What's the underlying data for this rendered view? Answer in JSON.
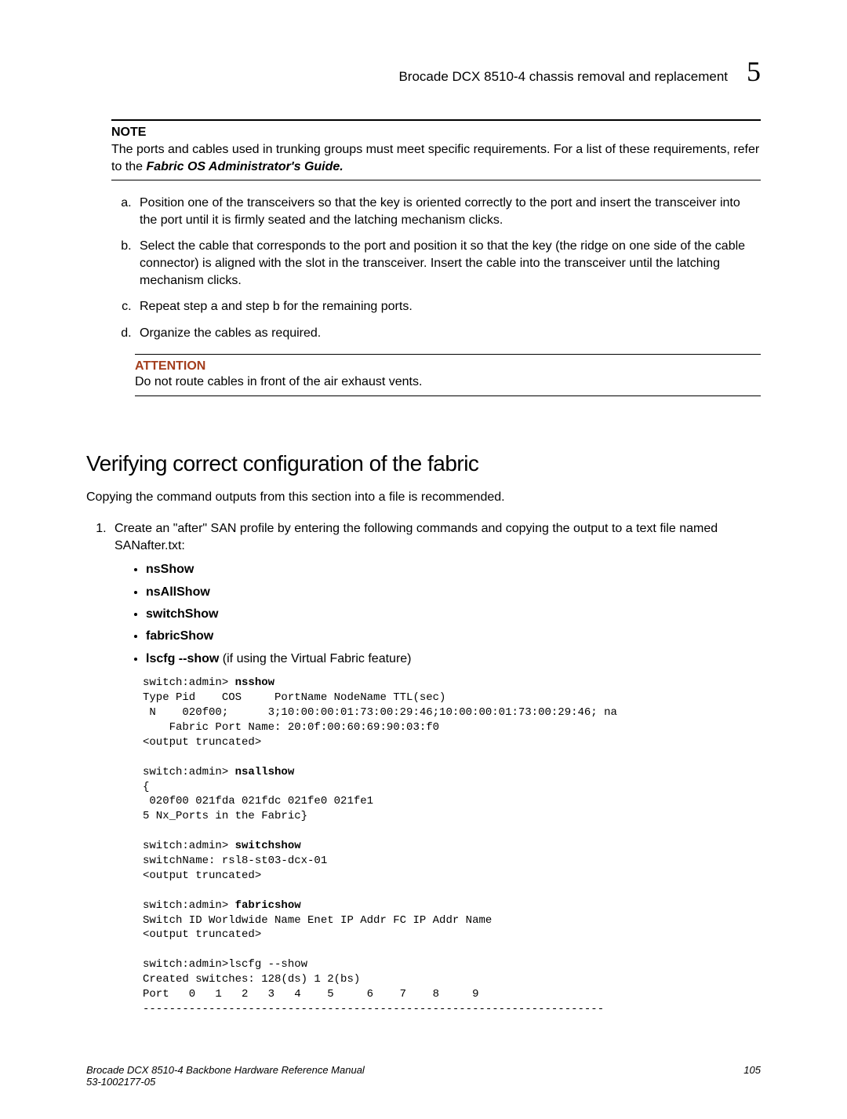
{
  "header": {
    "title": "Brocade DCX 8510-4 chassis removal and replacement",
    "chapter": "5"
  },
  "note": {
    "label": "NOTE",
    "text_before_italic": "The ports and cables used in trunking groups must meet specific requirements. For a list of these requirements, refer to the ",
    "italic": "Fabric OS Administrator's Guide."
  },
  "steps": [
    "Position one of the transceivers so that the key is oriented correctly to the port and insert the transceiver into the port until it is firmly seated and the latching mechanism clicks.",
    "Select the cable that corresponds to the port and position it so that the key (the ridge on one side of the cable connector) is aligned with the slot in the transceiver. Insert the cable into the transceiver until the latching mechanism clicks.",
    "Repeat step a and step b for the remaining ports.",
    "Organize the cables as required."
  ],
  "attention": {
    "label": "ATTENTION",
    "text": "Do not route cables in front of the air exhaust vents."
  },
  "section": {
    "heading": "Verifying correct configuration of the fabric",
    "intro": "Copying the command outputs from this section into a file is recommended.",
    "step1_text": "Create an \"after\" SAN profile by entering the following commands and copying the output to a text file named SANafter.txt:",
    "commands": [
      {
        "cmd": "nsShow",
        "suffix": ""
      },
      {
        "cmd": "nsAllShow",
        "suffix": ""
      },
      {
        "cmd": "switchShow",
        "suffix": ""
      },
      {
        "cmd": "fabricShow",
        "suffix": ""
      },
      {
        "cmd": "lscfg --show",
        "suffix": " (if using the Virtual Fabric feature)"
      }
    ],
    "code": {
      "p1": "switch:admin> ",
      "c1": "nsshow",
      "l2": "Type Pid    COS     PortName NodeName TTL(sec)",
      "l3": " N    020f00;      3;10:00:00:01:73:00:29:46;10:00:00:01:73:00:29:46; na",
      "l4": "    Fabric Port Name: 20:0f:00:60:69:90:03:f0",
      "l5": "<output truncated>",
      "blank1": "",
      "p2": "switch:admin> ",
      "c2": "nsallshow",
      "l7": "{",
      "l8": " 020f00 021fda 021fdc 021fe0 021fe1",
      "l9": "5 Nx_Ports in the Fabric}",
      "blank2": "",
      "p3": "switch:admin> ",
      "c3": "switchshow",
      "l11": "switchName: rsl8-st03-dcx-01",
      "l12": "<output truncated>",
      "blank3": "",
      "p4": "switch:admin> ",
      "c4": "fabricshow",
      "l14": "Switch ID Worldwide Name Enet IP Addr FC IP Addr Name",
      "l15": "<output truncated>",
      "blank4": "",
      "l16": "switch:admin>lscfg --show",
      "l17": "Created switches: 128(ds) 1 2(bs)",
      "l18": "Port   0   1   2   3   4    5     6    7    8     9",
      "l19": "----------------------------------------------------------------------"
    }
  },
  "footer": {
    "left_line1": "Brocade DCX 8510-4 Backbone Hardware Reference Manual",
    "left_line2": "53-1002177-05",
    "right": "105"
  }
}
